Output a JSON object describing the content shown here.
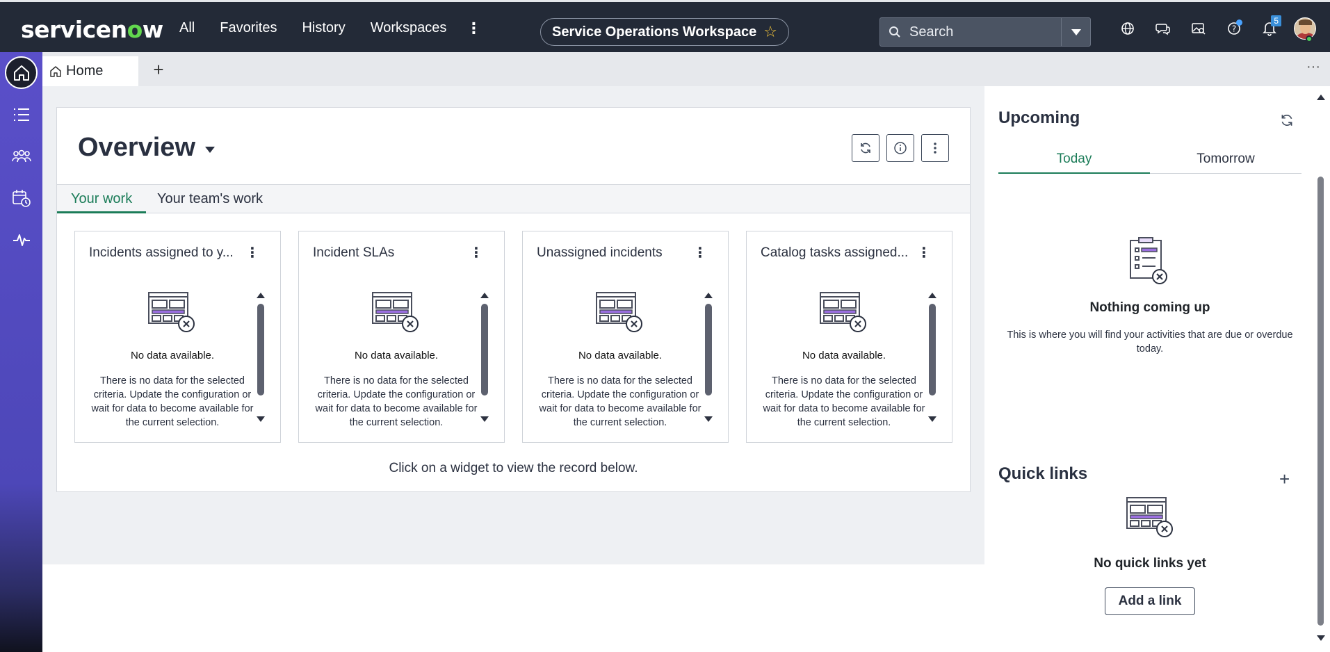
{
  "brand": {
    "logo_pre": "servicen",
    "logo_o": "o",
    "logo_post": "w",
    "accent": "#62d84e"
  },
  "nav": {
    "items": [
      "All",
      "Favorites",
      "History",
      "Workspaces"
    ],
    "more": "⋮"
  },
  "workspace": {
    "label": "Service Operations Workspace",
    "star": "☆"
  },
  "search": {
    "placeholder": "Search"
  },
  "notifications": {
    "count": "5"
  },
  "tabs": {
    "home": "Home",
    "add": "+",
    "more": "···"
  },
  "overview": {
    "title": "Overview",
    "tabs": [
      "Your work",
      "Your team's work"
    ],
    "hint": "Click on a widget to view the record below."
  },
  "widgets": [
    {
      "title": "Incidents assigned to y...",
      "no_data": "No data available.",
      "desc": "There is no data for the selected criteria. Update the configuration or wait for data to become available for the current selection."
    },
    {
      "title": "Incident SLAs",
      "no_data": "No data available.",
      "desc": "There is no data for the selected criteria. Update the configuration or wait for data to become available for the current selection."
    },
    {
      "title": "Unassigned incidents",
      "no_data": "No data available.",
      "desc": "There is no data for the selected criteria. Update the configuration or wait for data to become available for the current selection."
    },
    {
      "title": "Catalog tasks assigned...",
      "no_data": "No data available.",
      "desc": "There is no data for the selected criteria. Update the configuration or wait for data to become available for the current selection."
    }
  ],
  "upcoming": {
    "title": "Upcoming",
    "tabs": [
      "Today",
      "Tomorrow"
    ],
    "empty_title": "Nothing coming up",
    "empty_desc": "This is where you will find your activities that are due or overdue today."
  },
  "quick_links": {
    "title": "Quick links",
    "add": "+",
    "empty_title": "No quick links yet",
    "button": "Add a link"
  },
  "colors": {
    "topbar": "#232a37",
    "rail": "#5a4fc9",
    "active_tab": "#1b7c58"
  }
}
